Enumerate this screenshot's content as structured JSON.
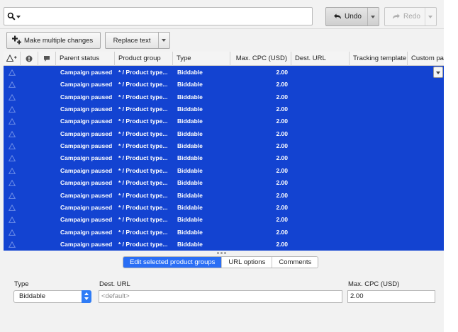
{
  "toolbar": {
    "search_placeholder": "",
    "undo_label": "Undo",
    "redo_label": "Redo",
    "make_multiple_label": "Make multiple changes",
    "replace_text_label": "Replace text"
  },
  "grid": {
    "columns": [
      "Parent status",
      "Product group",
      "Type",
      "Max. CPC (USD)",
      "Dest. URL",
      "Tracking template",
      "Custom pa"
    ],
    "rows": [
      {
        "parent_status": "Campaign paused",
        "product_group": "* / Product type...",
        "type": "Biddable",
        "max_cpc": "2.00"
      },
      {
        "parent_status": "Campaign paused",
        "product_group": "* / Product type...",
        "type": "Biddable",
        "max_cpc": "2.00"
      },
      {
        "parent_status": "Campaign paused",
        "product_group": "* / Product type...",
        "type": "Biddable",
        "max_cpc": "2.00"
      },
      {
        "parent_status": "Campaign paused",
        "product_group": "* / Product type...",
        "type": "Biddable",
        "max_cpc": "2.00"
      },
      {
        "parent_status": "Campaign paused",
        "product_group": "* / Product type...",
        "type": "Biddable",
        "max_cpc": "2.00"
      },
      {
        "parent_status": "Campaign paused",
        "product_group": "* / Product type...",
        "type": "Biddable",
        "max_cpc": "2.00"
      },
      {
        "parent_status": "Campaign paused",
        "product_group": "* / Product type...",
        "type": "Biddable",
        "max_cpc": "2.00"
      },
      {
        "parent_status": "Campaign paused",
        "product_group": "* / Product type...",
        "type": "Biddable",
        "max_cpc": "2.00"
      },
      {
        "parent_status": "Campaign paused",
        "product_group": "* / Product type...",
        "type": "Biddable",
        "max_cpc": "2.00"
      },
      {
        "parent_status": "Campaign paused",
        "product_group": "* / Product type...",
        "type": "Biddable",
        "max_cpc": "2.00"
      },
      {
        "parent_status": "Campaign paused",
        "product_group": "* / Product type...",
        "type": "Biddable",
        "max_cpc": "2.00"
      },
      {
        "parent_status": "Campaign paused",
        "product_group": "* / Product type...",
        "type": "Biddable",
        "max_cpc": "2.00"
      },
      {
        "parent_status": "Campaign paused",
        "product_group": "* / Product type...",
        "type": "Biddable",
        "max_cpc": "2.00"
      },
      {
        "parent_status": "Campaign paused",
        "product_group": "* / Product type...",
        "type": "Biddable",
        "max_cpc": "2.00"
      },
      {
        "parent_status": "Campaign paused",
        "product_group": "* / Product type...",
        "type": "Biddable",
        "max_cpc": "2.00"
      }
    ]
  },
  "tabs": [
    "Edit selected product groups",
    "URL options",
    "Comments"
  ],
  "form": {
    "type_label": "Type",
    "type_value": "Biddable",
    "dest_url_label": "Dest. URL",
    "dest_url_placeholder": "<default>",
    "max_cpc_label": "Max. CPC (USD)",
    "max_cpc_value": "2.00"
  },
  "colors": {
    "selection": "#1343d1",
    "active_tab": "#2a6ef5"
  }
}
